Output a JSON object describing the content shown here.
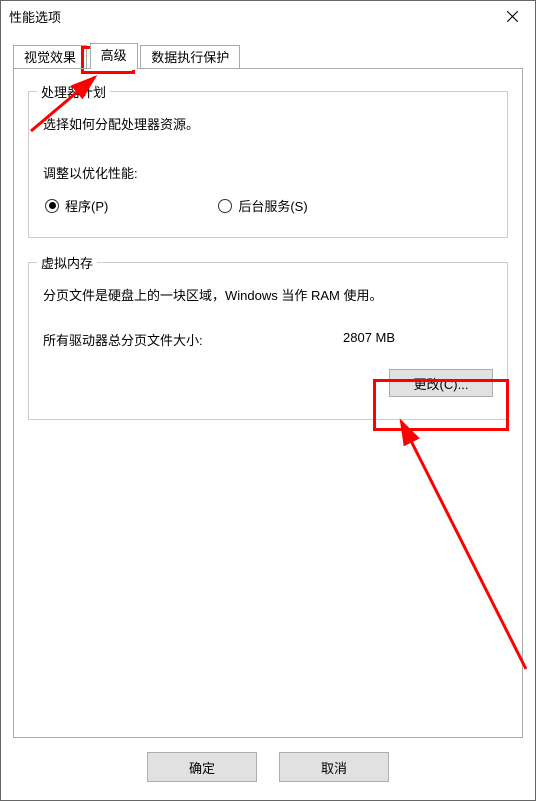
{
  "window": {
    "title": "性能选项"
  },
  "tabs": {
    "visual_effects": "视觉效果",
    "advanced": "高级",
    "dep": "数据执行保护"
  },
  "processor": {
    "legend": "处理器计划",
    "desc": "选择如何分配处理器资源。",
    "adjust_label": "调整以优化性能:",
    "programs": "程序(P)",
    "background": "后台服务(S)"
  },
  "vm": {
    "legend": "虚拟内存",
    "desc": "分页文件是硬盘上的一块区域，Windows 当作 RAM 使用。",
    "total_label": "所有驱动器总分页文件大小:",
    "total_value": "2807 MB",
    "change": "更改(C)..."
  },
  "buttons": {
    "ok": "确定",
    "cancel": "取消"
  }
}
